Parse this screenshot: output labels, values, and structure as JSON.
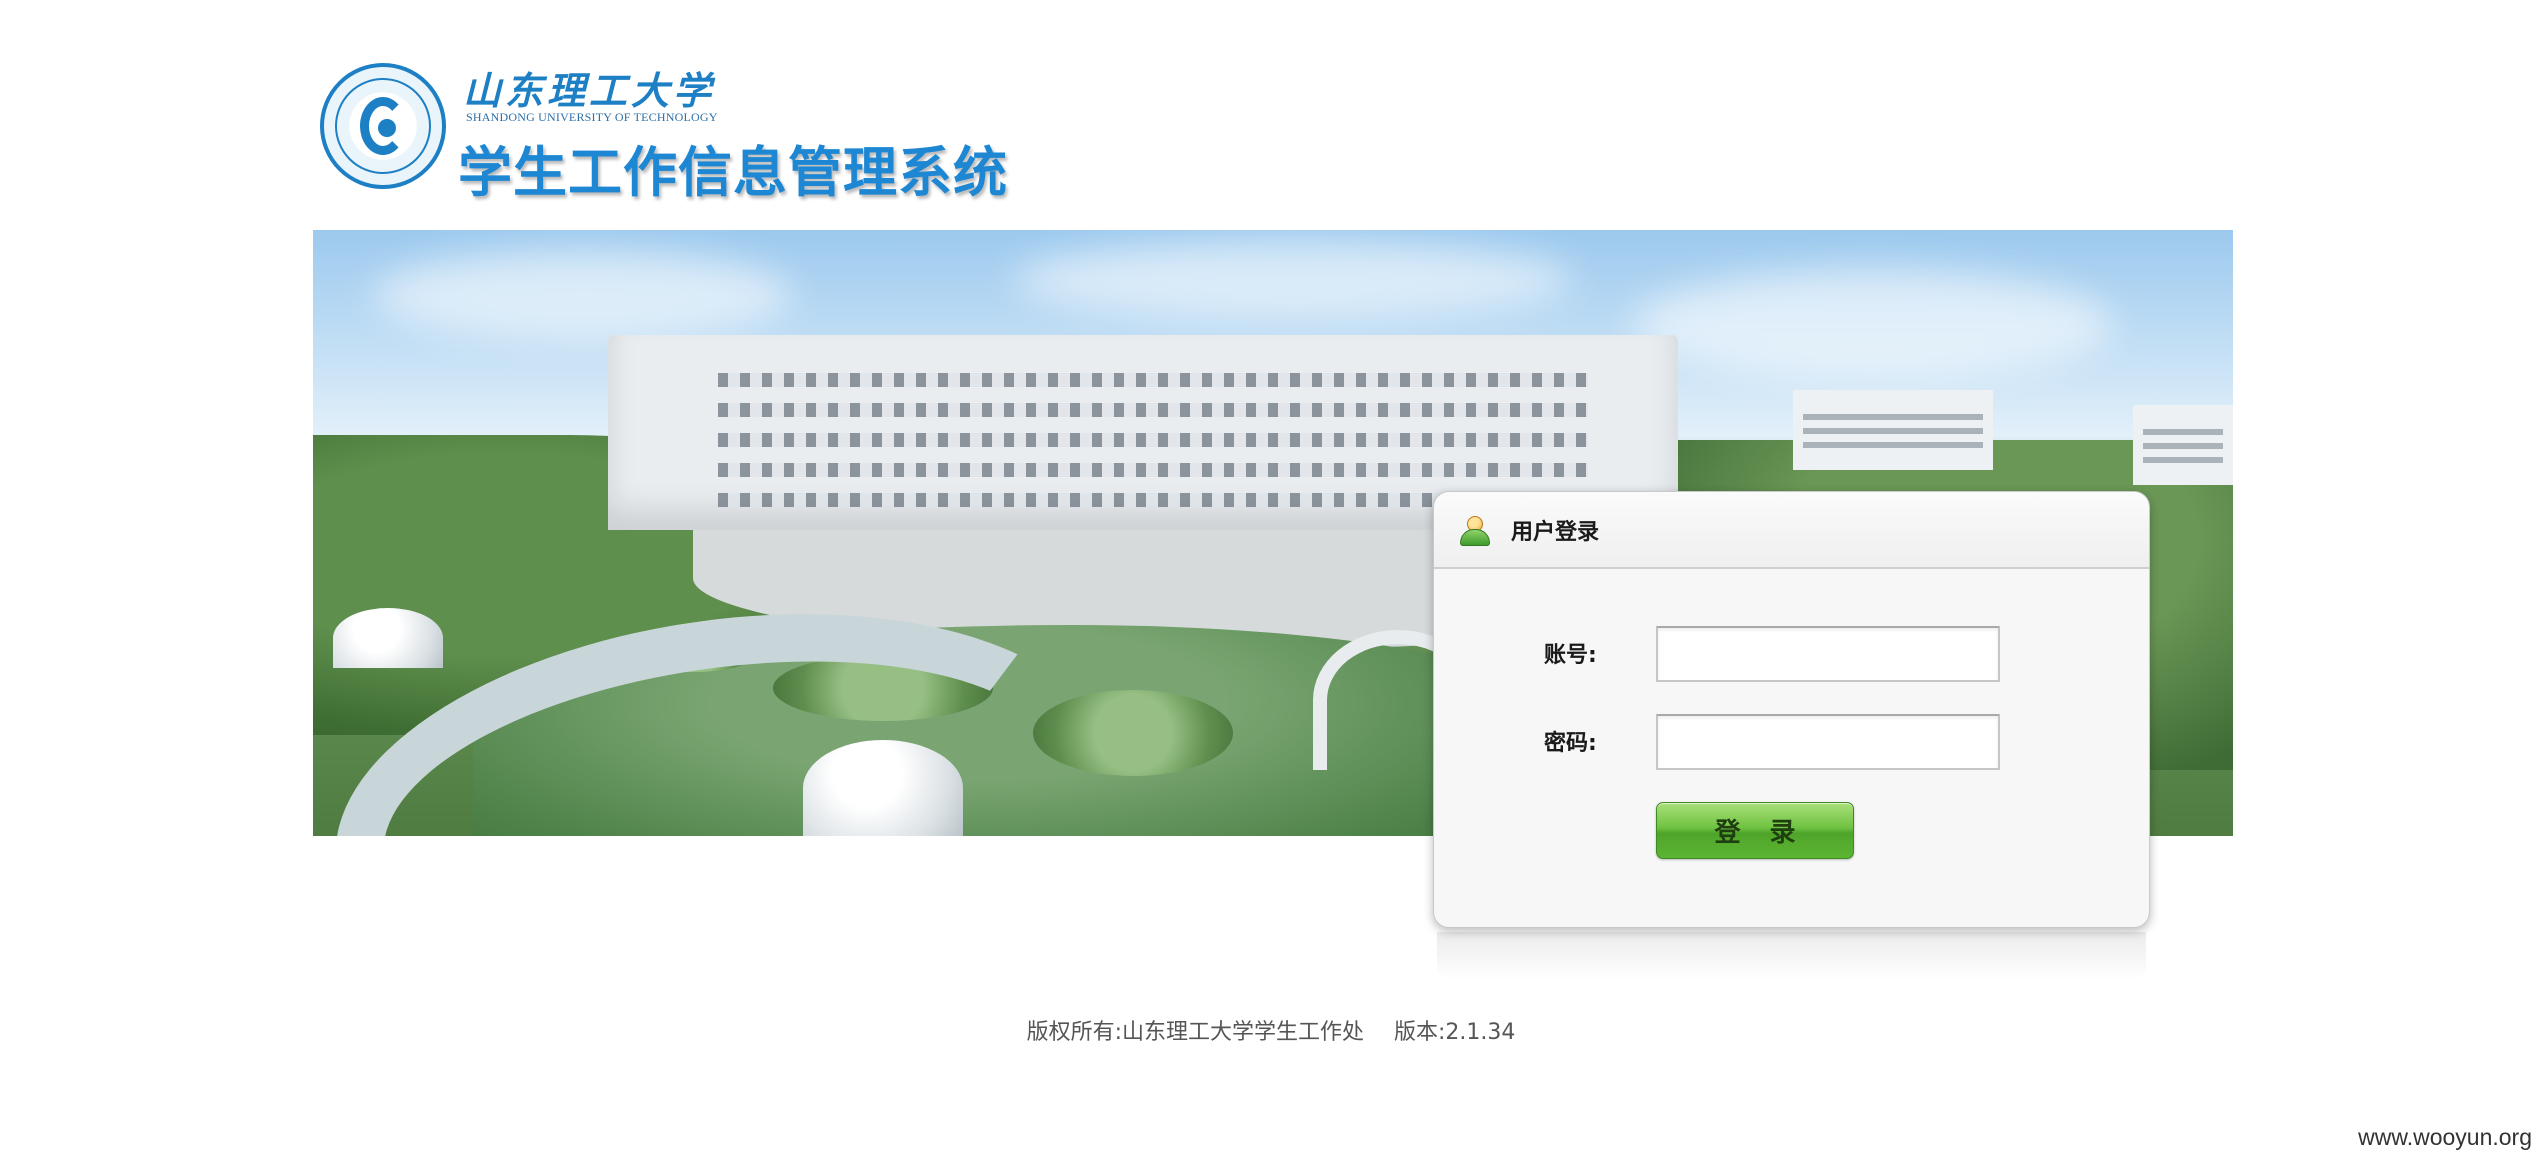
{
  "header": {
    "university_name": "山东理工大学",
    "university_name_en": "SHANDONG UNIVERSITY OF TECHNOLOGY",
    "system_title": "学生工作信息管理系统"
  },
  "login": {
    "title": "用户登录",
    "username_label": "账号:",
    "username_value": "",
    "password_label": "密码:",
    "password_value": "",
    "submit_label": "登 录"
  },
  "footer": {
    "copyright": "版权所有:山东理工大学学生工作处",
    "version": "版本:2.1.34"
  },
  "watermark": "www.wooyun.org",
  "colors": {
    "brand_blue": "#1d87d3",
    "button_green": "#5cb431",
    "panel_bg": "#f7f7f7"
  },
  "icons": {
    "logo": "university-seal-icon",
    "login_header": "user-icon"
  }
}
